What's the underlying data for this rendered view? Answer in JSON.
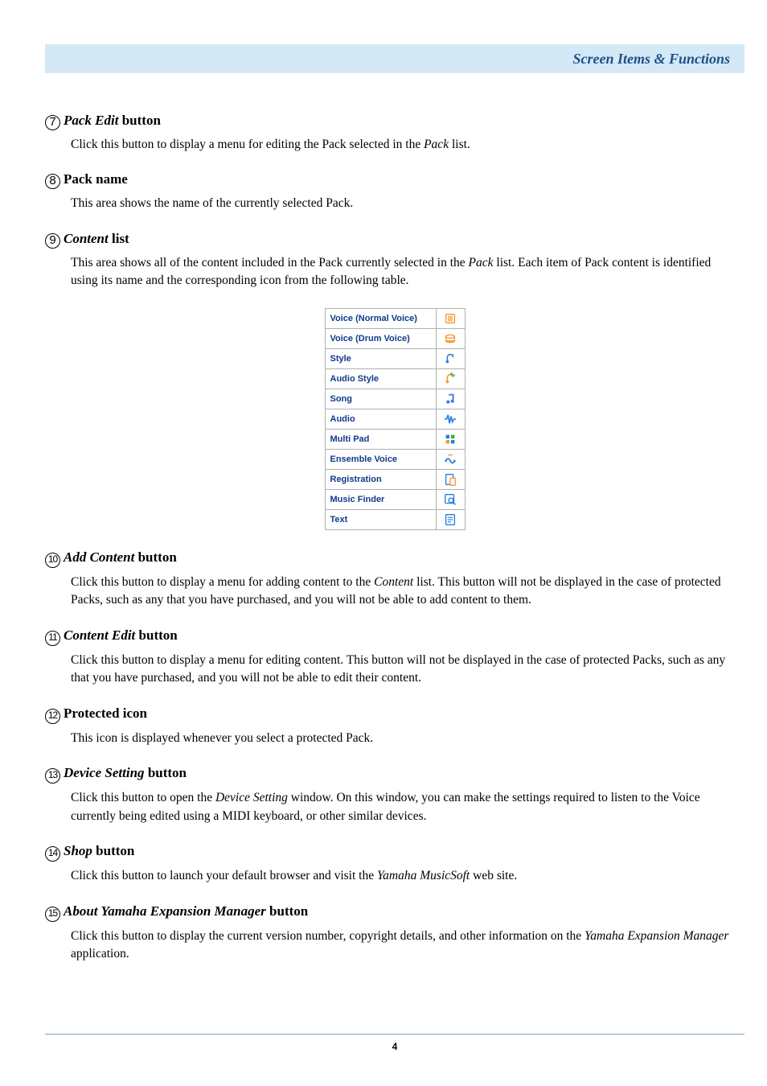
{
  "header": {
    "title": "Screen Items & Functions"
  },
  "items": {
    "i7": {
      "num": "7",
      "title_italic": "Pack Edit",
      "title_rest": " button",
      "desc": [
        [
          "Click this button to display a menu for editing the Pack selected in the ",
          0
        ],
        [
          "Pack",
          1
        ],
        [
          " list.",
          0
        ]
      ]
    },
    "i8": {
      "num": "8",
      "title_italic": "",
      "title_rest": "Pack name",
      "desc": [
        [
          "This area shows the name of the currently selected Pack.",
          0
        ]
      ]
    },
    "i9": {
      "num": "9",
      "title_italic": "Content",
      "title_rest": " list",
      "desc": [
        [
          "This area shows all of the content included in the Pack currently selected in the ",
          0
        ],
        [
          "Pack",
          1
        ],
        [
          " list. Each item of Pack content is identified using its name and the corresponding icon from the following table.",
          0
        ]
      ]
    },
    "i10": {
      "num": "10",
      "title_italic": "Add Content",
      "title_rest": " button",
      "desc": [
        [
          "Click this button to display a menu for adding content to the ",
          0
        ],
        [
          "Content",
          1
        ],
        [
          " list. This button will not be displayed in the case of protected Packs, such as any that you have purchased, and you will not be able to add content to them.",
          0
        ]
      ]
    },
    "i11": {
      "num": "11",
      "title_italic": "Content Edit",
      "title_rest": " button",
      "desc": [
        [
          "Click this button to display a menu for editing content. This button will not be displayed in the case of protected Packs, such as any that you have purchased, and you will not be able to edit their content.",
          0
        ]
      ]
    },
    "i12": {
      "num": "12",
      "title_italic": "",
      "title_rest": "Protected icon",
      "desc": [
        [
          "This icon is displayed whenever you select a protected Pack.",
          0
        ]
      ]
    },
    "i13": {
      "num": "13",
      "title_italic": "Device Setting",
      "title_rest": " button",
      "desc": [
        [
          "Click this button to open the ",
          0
        ],
        [
          "Device Setting",
          1
        ],
        [
          " window. On this window, you can make the settings required to listen to the Voice currently being edited using a MIDI keyboard, or other similar devices.",
          0
        ]
      ]
    },
    "i14": {
      "num": "14",
      "title_italic": "Shop",
      "title_rest": " button",
      "desc": [
        [
          "Click this button to launch your default browser and visit the ",
          0
        ],
        [
          "Yamaha MusicSoft",
          1
        ],
        [
          " web site.",
          0
        ]
      ]
    },
    "i15": {
      "num": "15",
      "title_italic": "About Yamaha Expansion Manager",
      "title_rest": " button",
      "desc": [
        [
          "Click this button to display the current version number, copyright details, and other information on the ",
          0
        ],
        [
          "Yamaha Expansion Manager",
          1
        ],
        [
          " application.",
          0
        ]
      ]
    }
  },
  "icon_table": [
    {
      "label": "Voice (Normal Voice)",
      "icon": "normal-voice"
    },
    {
      "label": "Voice (Drum Voice)",
      "icon": "drum-voice"
    },
    {
      "label": "Style",
      "icon": "style"
    },
    {
      "label": "Audio Style",
      "icon": "audio-style"
    },
    {
      "label": "Song",
      "icon": "song"
    },
    {
      "label": "Audio",
      "icon": "audio"
    },
    {
      "label": "Multi Pad",
      "icon": "multi-pad"
    },
    {
      "label": "Ensemble Voice",
      "icon": "ensemble-voice"
    },
    {
      "label": "Registration",
      "icon": "registration"
    },
    {
      "label": "Music Finder",
      "icon": "music-finder"
    },
    {
      "label": "Text",
      "icon": "text"
    }
  ],
  "colors": {
    "icon_blue": "#2a7de1",
    "icon_orange": "#f39a2f"
  },
  "footer": {
    "page": "4"
  }
}
